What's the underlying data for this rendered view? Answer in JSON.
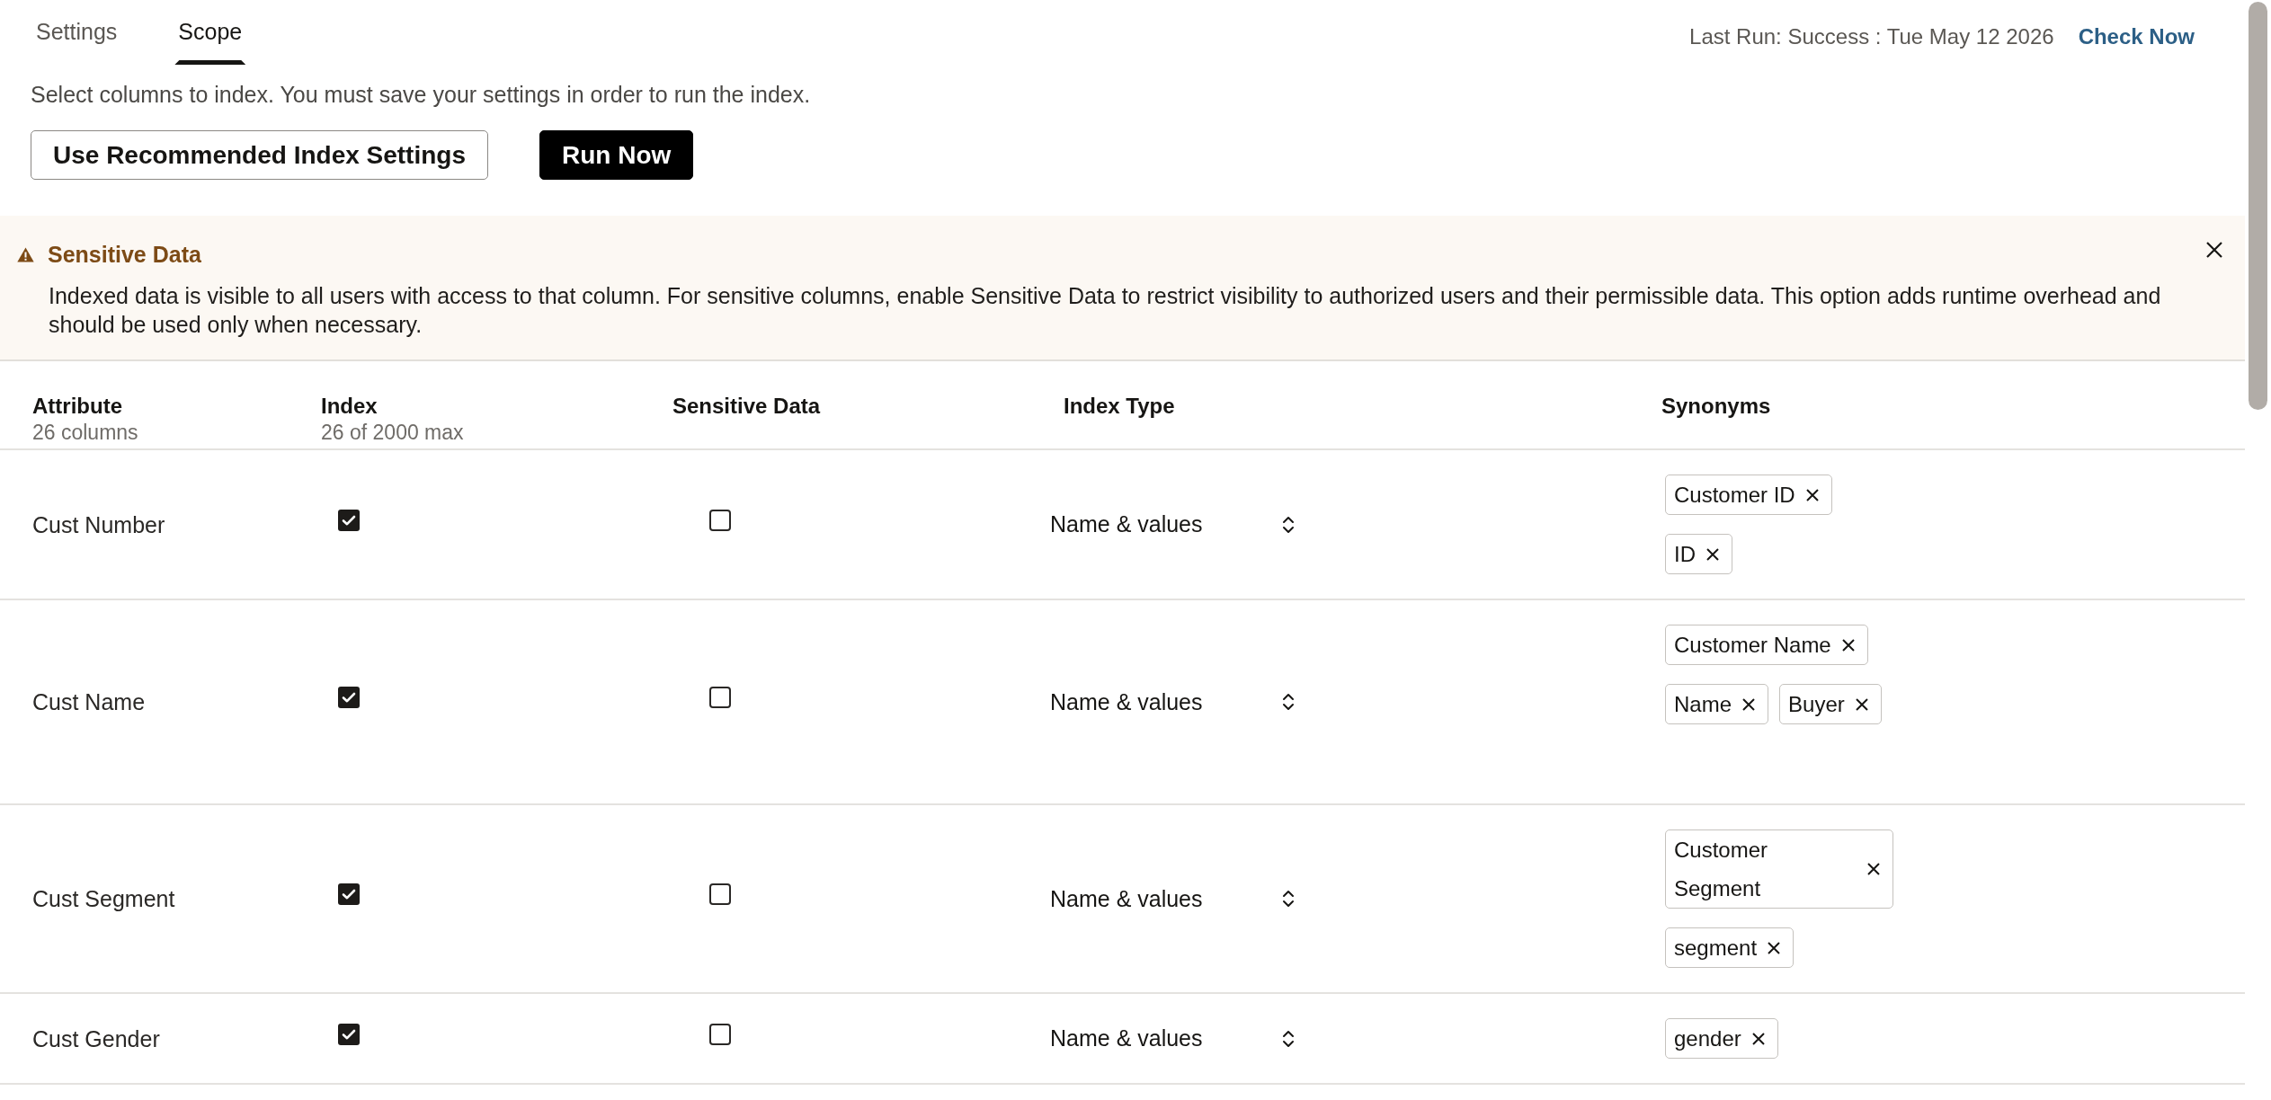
{
  "tabs": [
    {
      "label": "Settings",
      "selected": false
    },
    {
      "label": "Scope",
      "selected": true
    }
  ],
  "status": {
    "last_run": "Last Run: Success : Tue May 12 2026",
    "action": "Check Now"
  },
  "instructions": "Select columns to index. You must save your settings in order to run the index.",
  "buttons": [
    {
      "label": "Use Recommended Index Settings",
      "kind": "secondary"
    },
    {
      "label": "Run Now",
      "kind": "primary"
    }
  ],
  "banner": {
    "title": "Sensitive Data",
    "message": "Indexed data is visible to all users with access to that column. For sensitive columns, enable Sensitive Data to restrict visibility to authorized users and their permissible data. This option adds runtime overhead and should be used only when necessary."
  },
  "table": {
    "columns": [
      {
        "label": "Attribute",
        "sublabel": "26 columns"
      },
      {
        "label": "Index",
        "sublabel": "26 of 2000 max"
      },
      {
        "label": "Sensitive Data"
      },
      {
        "label": "Index Type"
      },
      {
        "label": "Synonyms"
      }
    ],
    "rows": [
      {
        "attribute": "Cust Number",
        "indexed": true,
        "sensitive": false,
        "index_type": "Name & values",
        "synonyms": [
          "Customer ID",
          "ID"
        ]
      },
      {
        "attribute": "Cust Name",
        "indexed": true,
        "sensitive": false,
        "index_type": "Name & values",
        "synonyms": [
          "Customer Name",
          "Name",
          "Buyer"
        ]
      },
      {
        "attribute": "Cust Segment",
        "indexed": true,
        "sensitive": false,
        "index_type": "Name & values",
        "synonyms": [
          "Customer Segment",
          "segment"
        ]
      },
      {
        "attribute": "Cust Gender",
        "indexed": true,
        "sensitive": false,
        "index_type": "Name & values",
        "synonyms": [
          "gender"
        ]
      }
    ]
  }
}
